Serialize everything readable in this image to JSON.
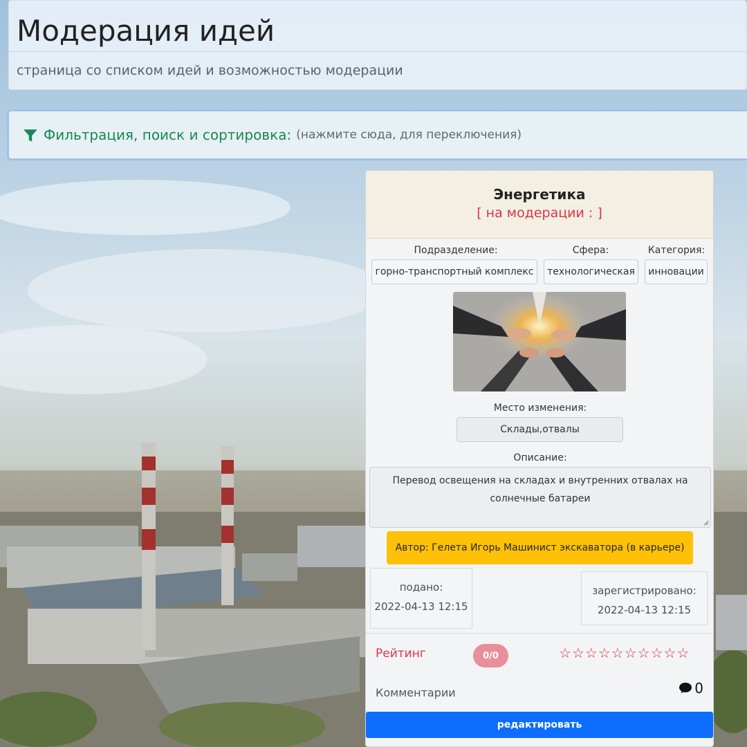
{
  "header": {
    "title": "Модерация идей",
    "subtitle": "страница со списком идей и возможностью модерации"
  },
  "filter": {
    "icon": "filter-icon",
    "title": "Фильтрация, поиск и сортировка:",
    "hint": "(нажмите сюда, для переключения)"
  },
  "card": {
    "title": "Энергетика",
    "status": "[ на модерации : ]",
    "division_label": "Подразделение:",
    "division": "горно-транспортный комплекс",
    "sphere_label": "Сфера:",
    "sphere": "технологическая",
    "category_label": "Категория:",
    "category": "инновации",
    "place_label": "Место изменения:",
    "place": "Склады,отвалы",
    "description_label": "Описание:",
    "description": "Перевод освещения на складах и внутренних отвалах на солнечные батареи",
    "author": "Автор: Гелета Игорь Машинист экскаватора (в карьере)",
    "submitted_label": "подано:",
    "submitted": "2022-04-13 12:15",
    "registered_label": "зарегистрировано:",
    "registered": "2022-04-13 12:15",
    "rating_label": "Рейтинг",
    "rating_value": "0/0",
    "stars_total": 10,
    "comments_label": "Комментарии",
    "comments_count": "0",
    "edit_button": "редактировать"
  },
  "colors": {
    "accent_green": "#198754",
    "status_red": "#dc3545",
    "author_yellow": "#ffc107",
    "primary_blue": "#0d6efd"
  }
}
